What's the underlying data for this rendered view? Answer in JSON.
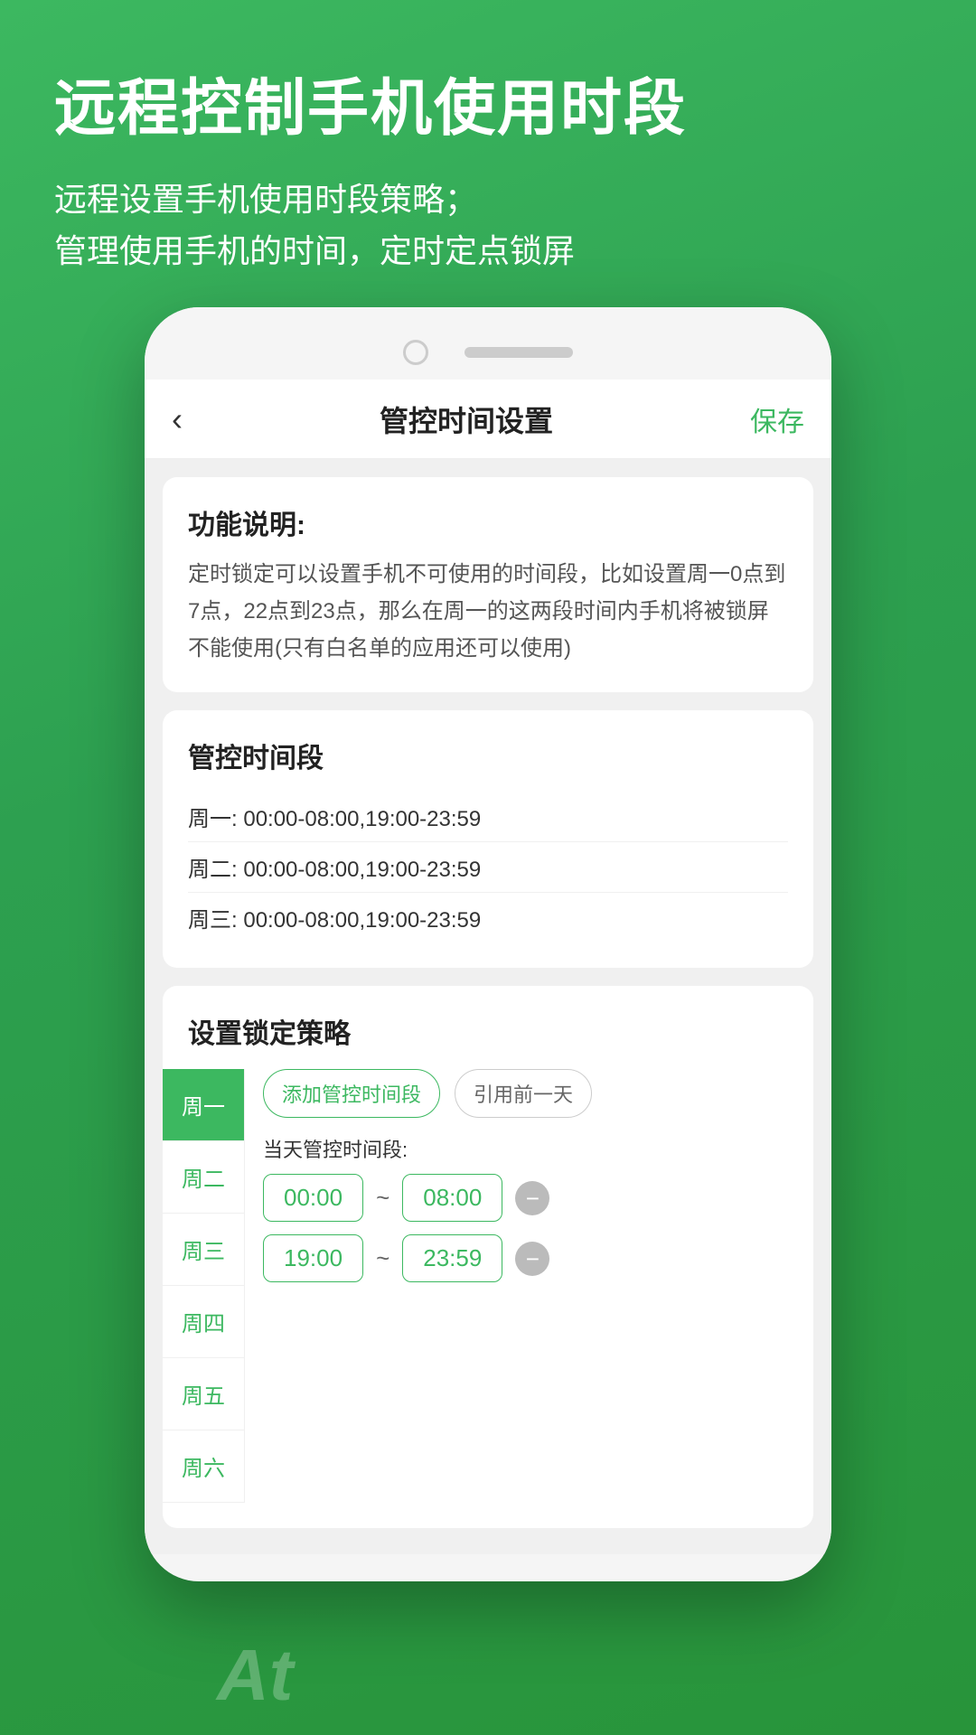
{
  "header": {
    "title": "远程控制手机使用时段",
    "subtitle_line1": "远程设置手机使用时段策略；",
    "subtitle_line2": "管理使用手机的时间，定时定点锁屏"
  },
  "navbar": {
    "back_icon": "‹",
    "title": "管控时间设置",
    "save_label": "保存"
  },
  "feature_card": {
    "title": "功能说明:",
    "description": "定时锁定可以设置手机不可使用的时间段，比如设置周一0点到7点，22点到23点，那么在周一的这两段时间内手机将被锁屏不能使用(只有白名单的应用还可以使用)"
  },
  "schedule_card": {
    "title": "管控时间段",
    "rows": [
      {
        "day": "周一:",
        "time": "00:00-08:00,19:00-23:59"
      },
      {
        "day": "周二:",
        "time": "00:00-08:00,19:00-23:59"
      },
      {
        "day": "周三:",
        "time": "00:00-08:00,19:00-23:59"
      }
    ]
  },
  "lock_strategy": {
    "title": "设置锁定策略",
    "add_button": "添加管控时间段",
    "copy_button": "引用前一天",
    "today_label": "当天管控时间段:",
    "days": [
      {
        "label": "周一",
        "active": true
      },
      {
        "label": "周二",
        "active": false
      },
      {
        "label": "周三",
        "active": false
      },
      {
        "label": "周四",
        "active": false
      },
      {
        "label": "周五",
        "active": false
      },
      {
        "label": "周六",
        "active": false
      }
    ],
    "time_ranges": [
      {
        "start": "00:00",
        "end": "08:00"
      },
      {
        "start": "19:00",
        "end": "23:59"
      }
    ]
  },
  "bottom_text": "At"
}
